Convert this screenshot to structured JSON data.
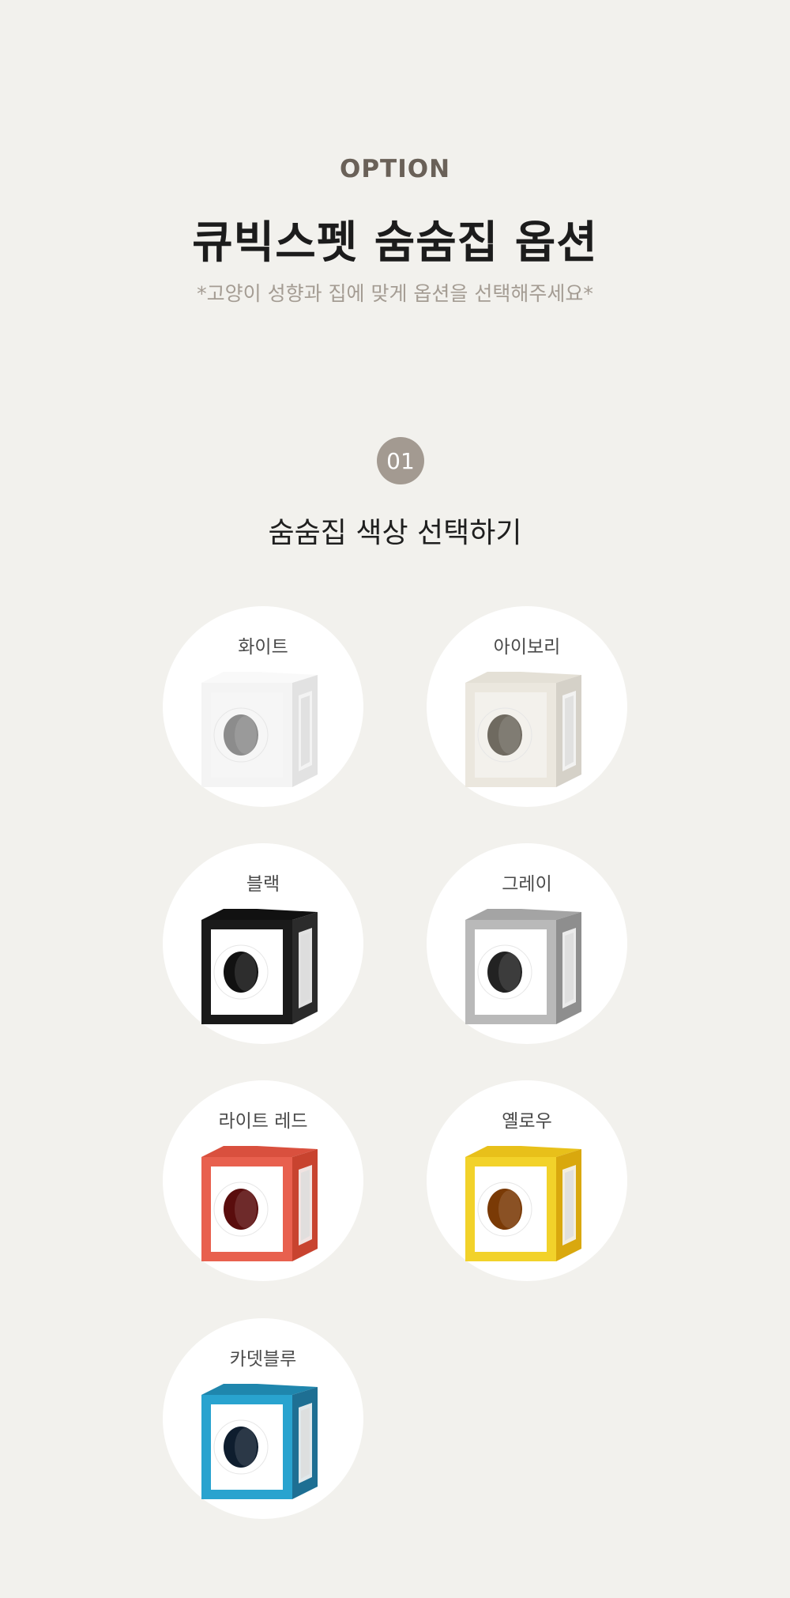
{
  "header": {
    "eyebrow": "OPTION",
    "title": "큐빅스펫 숨숨집 옵션",
    "subtitle": "*고양이 성향과 집에 맞게 옵션을 선택해주세요*"
  },
  "section": {
    "number": "01",
    "title": "숨숨집 색상 선택하기"
  },
  "options": [
    {
      "label": "화이트",
      "icon": "white-cube-house-icon",
      "frame": "#f4f4f4",
      "side": "#e2e2e2",
      "top": "#f9f9f9",
      "face": "#f6f6f6",
      "hole": "#8c8c8c"
    },
    {
      "label": "아이보리",
      "icon": "ivory-cube-house-icon",
      "frame": "#ebe7de",
      "side": "#d5d1c8",
      "top": "#e4e0d6",
      "face": "#f3f1ec",
      "hole": "#6f6a60"
    },
    {
      "label": "블랙",
      "icon": "black-cube-house-icon",
      "frame": "#1a1a1a",
      "side": "#2b2b2b",
      "top": "#111111",
      "face": "#ffffff",
      "hole": "#111111"
    },
    {
      "label": "그레이",
      "icon": "gray-cube-house-icon",
      "frame": "#b9b9b9",
      "side": "#8e8e8e",
      "top": "#a4a4a4",
      "face": "#ffffff",
      "hole": "#222222"
    },
    {
      "label": "라이트 레드",
      "icon": "light-red-cube-house-icon",
      "frame": "#e8604e",
      "side": "#c8432f",
      "top": "#d9503e",
      "face": "#ffffff",
      "hole": "#5a0d0d"
    },
    {
      "label": "옐로우",
      "icon": "yellow-cube-house-icon",
      "frame": "#f2d22a",
      "side": "#d9a80e",
      "top": "#e8c01a",
      "face": "#ffffff",
      "hole": "#7a3a06"
    },
    {
      "label": "카뎃블루",
      "icon": "cadet-blue-cube-house-icon",
      "frame": "#29a3cf",
      "side": "#1e6f93",
      "top": "#1f86ad",
      "face": "#ffffff",
      "hole": "#0e1d2e"
    }
  ]
}
